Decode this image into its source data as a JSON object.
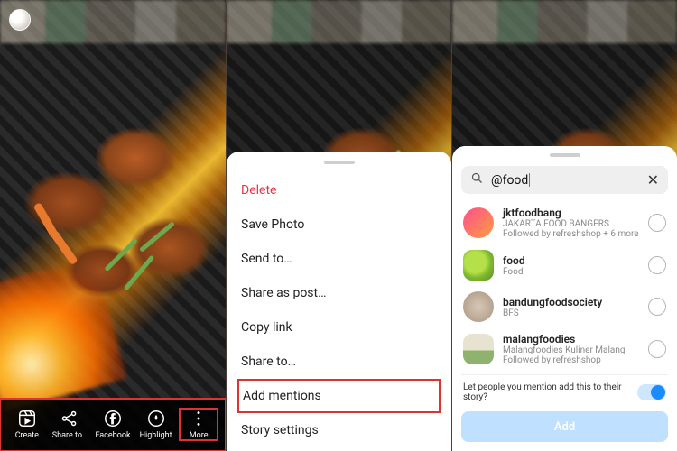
{
  "left": {
    "footer": {
      "create": "Create",
      "share_to": "Share to…",
      "facebook": "Facebook",
      "highlight": "Highlight",
      "more": "More"
    }
  },
  "center_sheet": {
    "delete": "Delete",
    "save_photo": "Save Photo",
    "send_to": "Send to…",
    "share_as_post": "Share as post…",
    "copy_link": "Copy link",
    "share_to": "Share to…",
    "add_mentions": "Add mentions",
    "story_settings": "Story settings"
  },
  "mentions": {
    "query": "@food",
    "results": [
      {
        "username": "jktfoodbang",
        "display": "JAKARTA FOOD BANGERS",
        "sub": "Followed by refreshshop + 6 more"
      },
      {
        "username": "food",
        "display": "Food",
        "sub": ""
      },
      {
        "username": "bandungfoodsociety",
        "display": "BFS",
        "sub": ""
      },
      {
        "username": "malangfoodies",
        "display": "Malangfoodies Kuliner Malang",
        "sub": "Followed by refreshshop"
      }
    ],
    "allow_label": "Let people you mention add this to their story?",
    "add_label": "Add"
  }
}
